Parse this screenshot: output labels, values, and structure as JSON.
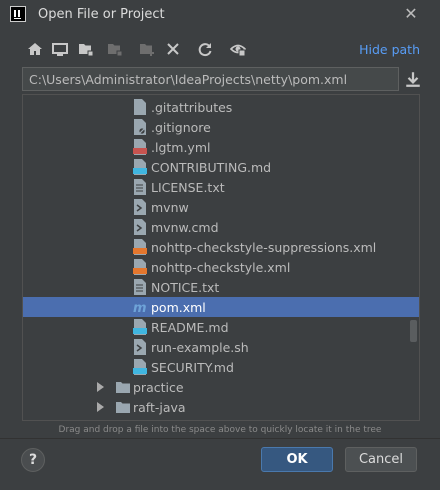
{
  "window": {
    "title": "Open File or Project",
    "app_icon": "intellij-icon",
    "close_icon": "close-icon"
  },
  "toolbar": {
    "buttons": [
      {
        "name": "home-icon"
      },
      {
        "name": "desktop-icon"
      },
      {
        "name": "project-folder-icon"
      },
      {
        "name": "module-folder-icon"
      },
      {
        "name": "new-folder-icon"
      },
      {
        "name": "delete-icon"
      },
      {
        "name": "refresh-icon"
      },
      {
        "name": "show-hidden-icon"
      }
    ],
    "hide_path_label": "Hide path"
  },
  "path": {
    "value": "C:\\Users\\Administrator\\IdeaProjects\\netty\\pom.xml"
  },
  "tree": {
    "items": [
      {
        "label": ".gitattributes",
        "icon": "gitattributes-icon",
        "selected": false
      },
      {
        "label": ".gitignore",
        "icon": "gitignore-icon",
        "selected": false
      },
      {
        "label": ".lgtm.yml",
        "icon": "yaml-file-icon",
        "selected": false
      },
      {
        "label": "CONTRIBUTING.md",
        "icon": "markdown-file-icon",
        "selected": false
      },
      {
        "label": "LICENSE.txt",
        "icon": "text-file-icon",
        "selected": false
      },
      {
        "label": "mvnw",
        "icon": "script-file-icon",
        "selected": false
      },
      {
        "label": "mvnw.cmd",
        "icon": "script-file-icon",
        "selected": false
      },
      {
        "label": "nohttp-checkstyle-suppressions.xml",
        "icon": "xml-file-icon",
        "selected": false
      },
      {
        "label": "nohttp-checkstyle.xml",
        "icon": "xml-file-icon",
        "selected": false
      },
      {
        "label": "NOTICE.txt",
        "icon": "text-file-icon",
        "selected": false
      },
      {
        "label": "pom.xml",
        "icon": "maven-icon",
        "selected": true
      },
      {
        "label": "README.md",
        "icon": "markdown-file-icon",
        "selected": false
      },
      {
        "label": "run-example.sh",
        "icon": "script-file-icon",
        "selected": false
      },
      {
        "label": "SECURITY.md",
        "icon": "markdown-file-icon",
        "selected": false
      }
    ],
    "folders": [
      {
        "label": "practice",
        "icon": "folder-icon"
      },
      {
        "label": "raft-java",
        "icon": "folder-icon"
      }
    ]
  },
  "hint": "Drag and drop a file into the space above to quickly locate it in the tree",
  "buttons": {
    "help": "?",
    "ok": "OK",
    "cancel": "Cancel"
  }
}
